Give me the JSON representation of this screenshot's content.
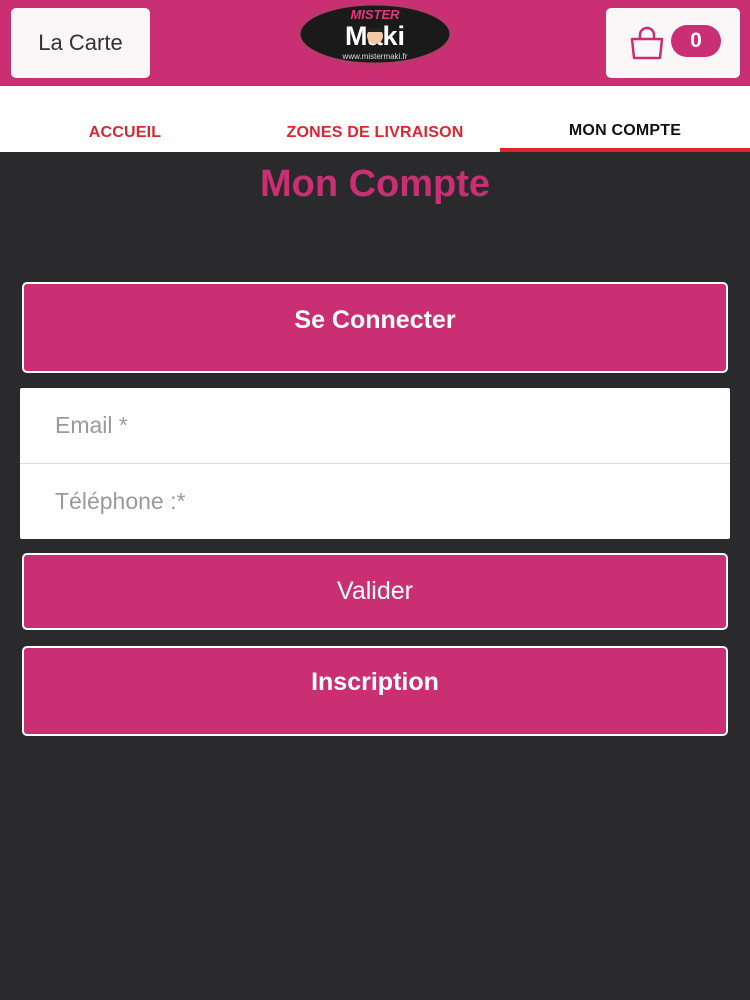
{
  "header": {
    "carte_label": "La Carte",
    "logo": {
      "top_text": "MISTER",
      "main_text": "Maki",
      "url_text": "www.mistermaki.fr"
    },
    "cart": {
      "icon": "shopping-bag-icon",
      "count": "0"
    }
  },
  "nav": {
    "tabs": [
      {
        "label": "ACCUEIL"
      },
      {
        "label": "ZONES DE LIVRAISON"
      },
      {
        "label": "MON COMPTE",
        "active": true
      }
    ]
  },
  "page": {
    "title": "Mon Compte",
    "login_button": "Se Connecter",
    "email_placeholder": "Email *",
    "phone_placeholder": "Téléphone :*",
    "submit_button": "Valider",
    "signup_button": "Inscription"
  },
  "colors": {
    "brand": "#c92f72",
    "accent_red": "#e0242f",
    "background": "#2a2a2c"
  }
}
